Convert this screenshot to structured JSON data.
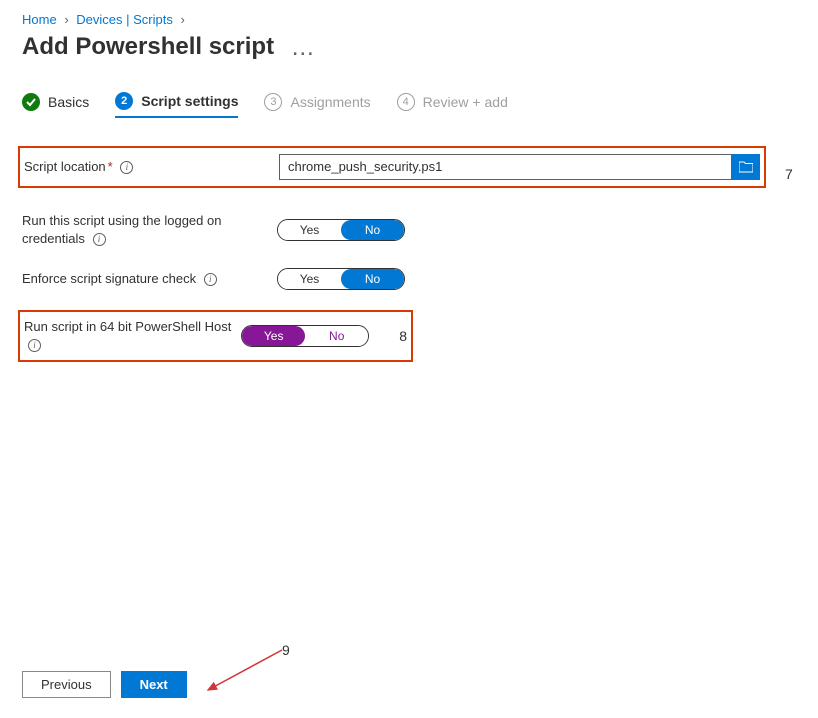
{
  "breadcrumb": {
    "home": "Home",
    "devices": "Devices | Scripts"
  },
  "page": {
    "title": "Add Powershell script",
    "ellipsis": "…"
  },
  "wizard": {
    "step1": "Basics",
    "step2": "Script settings",
    "step3": "Assignments",
    "step4": "Review + add",
    "n3": "3",
    "n4": "4"
  },
  "form": {
    "script_location_label": "Script location",
    "script_location_value": "chrome_push_security.ps1",
    "run_logged_on_label": "Run this script using the logged on credentials",
    "enforce_sig_label": "Enforce script signature check",
    "run_64_label": "Run script in 64 bit PowerShell Host",
    "yes": "Yes",
    "no": "No"
  },
  "annotations": {
    "a7": "7",
    "a8": "8",
    "a9": "9"
  },
  "footer": {
    "previous": "Previous",
    "next": "Next"
  }
}
